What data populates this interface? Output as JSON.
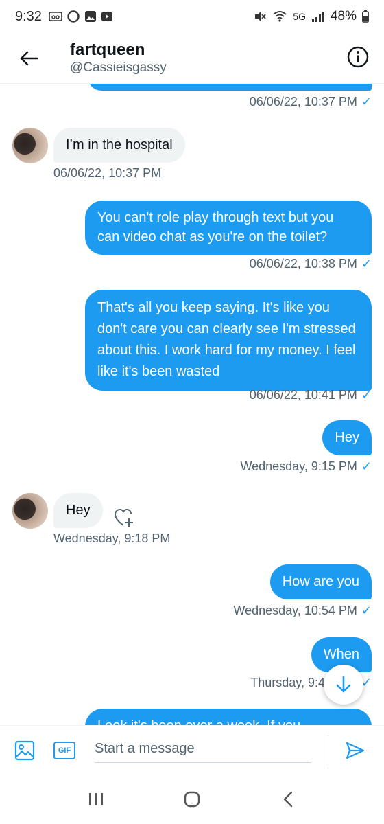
{
  "status_bar": {
    "time": "9:32",
    "network": "5G",
    "battery": "48%"
  },
  "header": {
    "name": "fartqueen",
    "handle": "@Cassieisgassy"
  },
  "messages": [
    {
      "id": "m0",
      "direction": "outgoing",
      "text": "",
      "timestamp": "06/06/22, 10:37 PM"
    },
    {
      "id": "m1",
      "direction": "incoming",
      "text": "I’m in the hospital",
      "timestamp": "06/06/22, 10:37 PM"
    },
    {
      "id": "m2",
      "direction": "outgoing",
      "text": "You can't role play through text but you can video chat as you're on the toilet?",
      "timestamp": "06/06/22, 10:38 PM"
    },
    {
      "id": "m3",
      "direction": "outgoing",
      "text": "That's all you keep saying. It's like you don't care you can clearly see I'm stressed about this. I work hard for my money. I feel like it's been wasted",
      "timestamp": "06/06/22, 10:41 PM"
    },
    {
      "id": "m4",
      "direction": "outgoing",
      "text": "Hey",
      "timestamp": "Wednesday, 9:15 PM"
    },
    {
      "id": "m5",
      "direction": "incoming",
      "text": "Hey",
      "timestamp": "Wednesday, 9:18 PM"
    },
    {
      "id": "m6",
      "direction": "outgoing",
      "text": "How are you",
      "timestamp": "Wednesday, 10:54 PM"
    },
    {
      "id": "m7",
      "direction": "outgoing",
      "text": "When",
      "timestamp": "Thursday, 9:4"
    },
    {
      "id": "m8",
      "direction": "outgoing",
      "text": "Look it's been over a week. If you",
      "timestamp": ""
    }
  ],
  "composer": {
    "placeholder": "Start a message",
    "gif_label": "GIF"
  },
  "icons": {
    "back": "arrow-left-icon",
    "info": "info-icon",
    "media": "image-icon",
    "gif": "gif-icon",
    "send": "send-icon",
    "scroll": "arrow-down-icon",
    "react": "heart-plus-icon"
  },
  "colors": {
    "accent": "#1d9bf0",
    "incoming_bubble": "#eff3f4",
    "secondary_text": "#536471"
  }
}
